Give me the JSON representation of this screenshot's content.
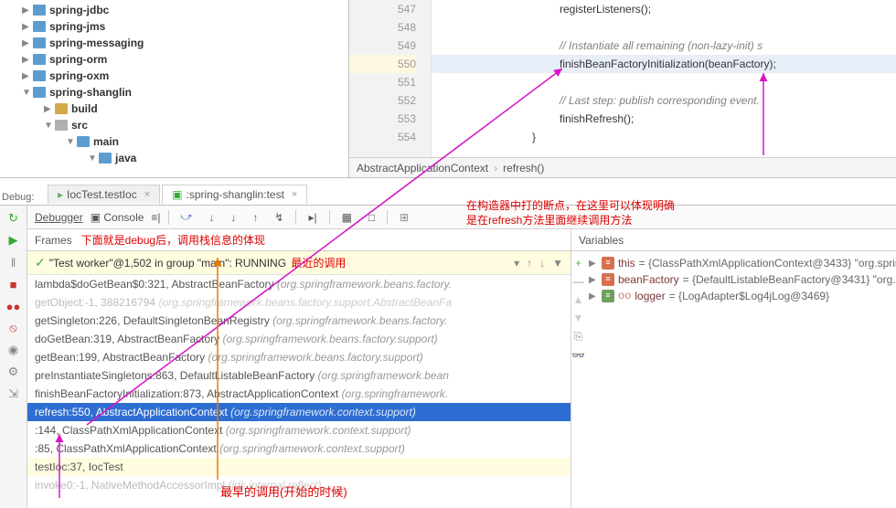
{
  "tree": [
    {
      "level": 1,
      "arrow": "▶",
      "icon": "blue",
      "label": "spring-jdbc"
    },
    {
      "level": 1,
      "arrow": "▶",
      "icon": "blue",
      "label": "spring-jms"
    },
    {
      "level": 1,
      "arrow": "▶",
      "icon": "blue",
      "label": "spring-messaging"
    },
    {
      "level": 1,
      "arrow": "▶",
      "icon": "blue",
      "label": "spring-orm"
    },
    {
      "level": 1,
      "arrow": "▶",
      "icon": "blue",
      "label": "spring-oxm"
    },
    {
      "level": 1,
      "arrow": "▼",
      "icon": "blue",
      "label": "spring-shanglin"
    },
    {
      "level": 2,
      "arrow": "▶",
      "icon": "tan",
      "label": "build"
    },
    {
      "level": 2,
      "arrow": "▼",
      "icon": "gray",
      "label": "src"
    },
    {
      "level": 3,
      "arrow": "▼",
      "icon": "blue",
      "label": "main"
    },
    {
      "level": 4,
      "arrow": "▼",
      "icon": "blue",
      "label": "java"
    }
  ],
  "code": {
    "lines": [
      {
        "num": "547",
        "text": "registerListeners();",
        "hl": false
      },
      {
        "num": "548",
        "text": "",
        "hl": false
      },
      {
        "num": "549",
        "text": "// Instantiate all remaining (non-lazy-init) s",
        "hl": false,
        "comment": true
      },
      {
        "num": "550",
        "text": "finishBeanFactoryInitialization(beanFactory);",
        "hl": true
      },
      {
        "num": "551",
        "text": "",
        "hl": false
      },
      {
        "num": "552",
        "text": "// Last step: publish corresponding event.",
        "hl": false,
        "comment": true
      },
      {
        "num": "553",
        "text": "finishRefresh();",
        "hl": false
      },
      {
        "num": "554",
        "text": "}",
        "hl": false,
        "outdent": true
      }
    ]
  },
  "breadcrumb": {
    "a": "AbstractApplicationContext",
    "b": "refresh()"
  },
  "debug": {
    "label": "Debug:",
    "tab1": "IocTest.testIoc",
    "tab2": ":spring-shanglin:test",
    "debugger": "Debugger",
    "console": "Console",
    "frames": "Frames",
    "variables": "Variables",
    "thread": "\"Test worker\"@1,502 in group \"main\": RUNNING",
    "stack": [
      {
        "text": "lambda$doGetBean$0:321, AbstractBeanFactory",
        "pkg": "(org.springframework.beans.factory.",
        "cls": ""
      },
      {
        "text": "getObject:-1, 388216794",
        "pkg": "(org.springframework.beans.factory.support.AbstractBeanFa",
        "cls": "dim"
      },
      {
        "text": "getSingleton:226, DefaultSingletonBeanRegistry",
        "pkg": "(org.springframework.beans.factory.",
        "cls": ""
      },
      {
        "text": "doGetBean:319, AbstractBeanFactory",
        "pkg": "(org.springframework.beans.factory.support)",
        "cls": ""
      },
      {
        "text": "getBean:199, AbstractBeanFactory",
        "pkg": "(org.springframework.beans.factory.support)",
        "cls": ""
      },
      {
        "text": "preInstantiateSingletons:863, DefaultListableBeanFactory",
        "pkg": "(org.springframework.bean",
        "cls": ""
      },
      {
        "text": "finishBeanFactoryInitialization:873, AbstractApplicationContext",
        "pkg": "(org.springframework.",
        "cls": ""
      },
      {
        "text": "refresh:550, AbstractApplicationContext",
        "pkg": "(org.springframework.context.support)",
        "cls": "selected"
      },
      {
        "text": "<init>:144, ClassPathXmlApplicationContext",
        "pkg": "(org.springframework.context.support)",
        "cls": ""
      },
      {
        "text": "<init>:85, ClassPathXmlApplicationContext",
        "pkg": "(org.springframework.context.support)",
        "cls": ""
      },
      {
        "text": "testIoc:37, IocTest",
        "pkg": "",
        "cls": "yellow"
      },
      {
        "text": "invoke0:-1, NativeMethodAccessorImpl",
        "pkg": "(jdk.internal.reflect)",
        "cls": "dim"
      }
    ],
    "vars": [
      {
        "icon": "red",
        "name": "this",
        "val": " = {ClassPathXmlApplicationContext@3433}  \"org.springframew"
      },
      {
        "icon": "red",
        "name": "beanFactory",
        "val": " = {DefaultListableBeanFactory@3431} \"org.springfra"
      },
      {
        "icon": "green",
        "name": "logger",
        "val": " = {LogAdapter$Log4jLog@3469}",
        "oo": true
      }
    ]
  },
  "annot": {
    "top": "在构造器中打的断点，在这里可以体现明确\n是在refresh方法里面继续调用方法",
    "frames": "下面就是debug后，调用栈信息的体现",
    "recent": "最近的调用",
    "earliest": "最早的调用(开始的时候)"
  }
}
